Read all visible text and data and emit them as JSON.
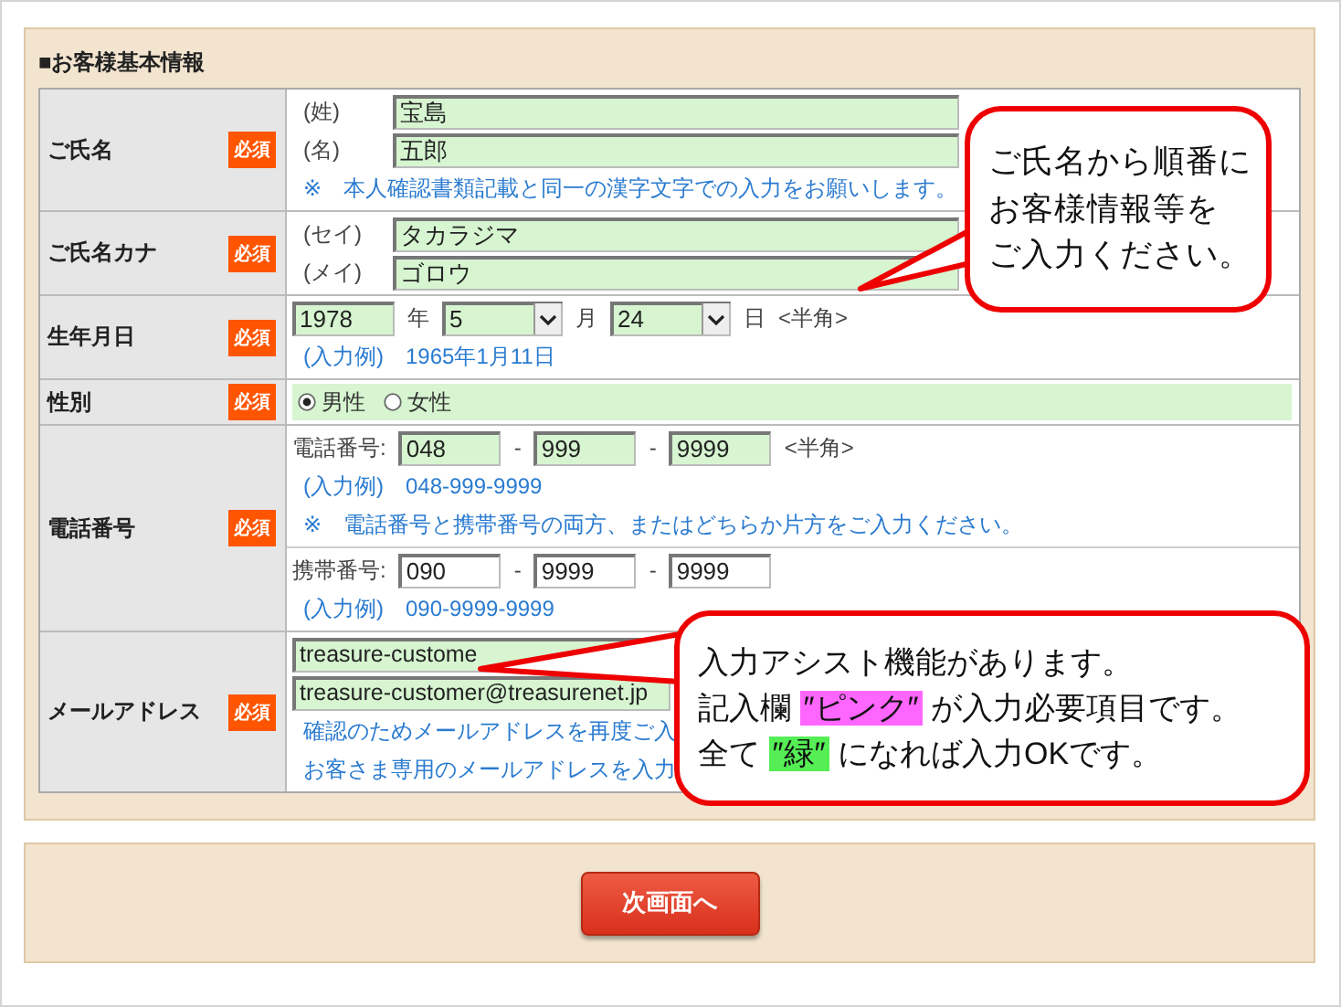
{
  "section_title": "■お客様基本情報",
  "rows": [
    {
      "label": "ご氏名",
      "required": true,
      "badge": "必須",
      "blocks": [
        {
          "lines": [
            {
              "items": [
                {
                  "kind": "prefix",
                  "text": "(姓)"
                },
                {
                  "kind": "input-wide",
                  "value": "宝島",
                  "valid": true
                }
              ]
            },
            {
              "items": [
                {
                  "kind": "prefix",
                  "text": "(名)"
                },
                {
                  "kind": "input-wide",
                  "value": "五郎",
                  "valid": true
                }
              ]
            },
            {
              "items": [
                {
                  "kind": "note",
                  "text": "※　本人確認書類記載と同一の漢字文字での入力をお願いします。"
                }
              ]
            }
          ]
        }
      ]
    },
    {
      "label": "ご氏名カナ",
      "required": true,
      "badge": "必須",
      "blocks": [
        {
          "lines": [
            {
              "items": [
                {
                  "kind": "prefix",
                  "text": "(セイ)"
                },
                {
                  "kind": "input-wide",
                  "value": "タカラジマ",
                  "valid": true
                }
              ]
            },
            {
              "items": [
                {
                  "kind": "prefix",
                  "text": "(メイ)"
                },
                {
                  "kind": "input-wide",
                  "value": "ゴロウ",
                  "valid": true
                }
              ]
            }
          ]
        }
      ]
    },
    {
      "label": "生年月日",
      "required": true,
      "badge": "必須",
      "blocks": [
        {
          "lines": [
            {
              "items": [
                {
                  "kind": "input",
                  "value": "1978",
                  "valid": true
                },
                {
                  "kind": "text",
                  "text": "年"
                },
                {
                  "kind": "select",
                  "value": "5",
                  "valid": true
                },
                {
                  "kind": "text",
                  "text": "月"
                },
                {
                  "kind": "select",
                  "value": "24",
                  "valid": true
                },
                {
                  "kind": "text",
                  "text": "日"
                },
                {
                  "kind": "text",
                  "text": "<半角>"
                }
              ]
            },
            {
              "items": [
                {
                  "kind": "note",
                  "text": "(入力例)　1965年1月11日"
                }
              ]
            }
          ]
        }
      ]
    },
    {
      "label": "性別",
      "required": true,
      "badge": "必須",
      "blocks": [
        {
          "lines": [
            {
              "valid": true,
              "items": [
                {
                  "kind": "radio",
                  "text": "男性",
                  "selected": true
                },
                {
                  "kind": "radio",
                  "text": "女性",
                  "selected": false
                }
              ]
            }
          ]
        }
      ]
    },
    {
      "label": "電話番号",
      "required": true,
      "badge": "必須",
      "blocks": [
        {
          "lines": [
            {
              "items": [
                {
                  "kind": "text",
                  "text": "電話番号:"
                },
                {
                  "kind": "input",
                  "value": "048",
                  "valid": true
                },
                {
                  "kind": "text",
                  "text": "-"
                },
                {
                  "kind": "input",
                  "value": "999",
                  "valid": true
                },
                {
                  "kind": "text",
                  "text": "-"
                },
                {
                  "kind": "input",
                  "value": "9999",
                  "valid": true
                },
                {
                  "kind": "text",
                  "text": "<半角>"
                }
              ]
            },
            {
              "items": [
                {
                  "kind": "note",
                  "text": "(入力例)　048-999-9999"
                }
              ]
            },
            {
              "items": [
                {
                  "kind": "note",
                  "text": "※　電話番号と携帯番号の両方、またはどちらか片方をご入力ください。"
                }
              ]
            }
          ]
        },
        {
          "lines": [
            {
              "items": [
                {
                  "kind": "text",
                  "text": "携帯番号:"
                },
                {
                  "kind": "input",
                  "value": "090",
                  "valid": false
                },
                {
                  "kind": "text",
                  "text": "-"
                },
                {
                  "kind": "input",
                  "value": "9999",
                  "valid": false
                },
                {
                  "kind": "text",
                  "text": "-"
                },
                {
                  "kind": "input",
                  "value": "9999",
                  "valid": false
                }
              ]
            },
            {
              "items": [
                {
                  "kind": "note",
                  "text": "(入力例)　090-9999-9999"
                }
              ]
            }
          ]
        }
      ]
    },
    {
      "label": "メールアドレス",
      "required": true,
      "badge": "必須",
      "blocks": [
        {
          "lines": [
            {
              "items": [
                {
                  "kind": "input-email",
                  "value": "treasure-custome",
                  "valid": true
                }
              ]
            },
            {
              "items": [
                {
                  "kind": "input-email",
                  "value": "treasure-customer@treasurenet.jp",
                  "valid": true
                }
              ]
            },
            {
              "items": [
                {
                  "kind": "note",
                  "text": "確認のためメールアドレスを再度ご入"
                }
              ]
            },
            {
              "items": [
                {
                  "kind": "note",
                  "text": "お客さま専用のメールアドレスを入力"
                }
              ]
            }
          ]
        }
      ]
    }
  ],
  "callouts": [
    {
      "kind": "top",
      "lines": [
        [
          {
            "text": "ご氏名から順番に"
          }
        ],
        [
          {
            "text": "お客様情報等を"
          }
        ],
        [
          {
            "text": "ご入力ください。"
          }
        ]
      ]
    },
    {
      "kind": "bottom",
      "lines": [
        [
          {
            "text": "入力アシスト機能があります。"
          }
        ],
        [
          {
            "text": "記入欄 "
          },
          {
            "text": "″ピンク″",
            "color": "#ff66ff"
          },
          {
            "text": " が入力必要項目です。"
          }
        ],
        [
          {
            "text": "全て "
          },
          {
            "text": "″緑″",
            "color": "#55ee55"
          },
          {
            "text": " になれば入力OKです。"
          }
        ]
      ]
    }
  ],
  "next_button": "次画面へ"
}
